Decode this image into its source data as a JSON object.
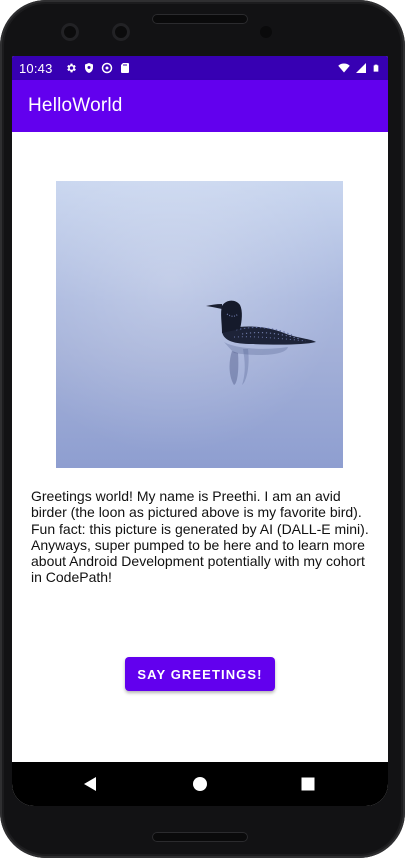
{
  "status_bar": {
    "time": "10:43",
    "left_icons": [
      "gear-icon",
      "shield-icon",
      "at-sign-icon",
      "sd-card-icon"
    ],
    "right_icons": [
      "wifi-icon",
      "signal-icon",
      "battery-icon"
    ]
  },
  "app_bar": {
    "title": "HelloWorld"
  },
  "main": {
    "image_subject": "loon-on-water",
    "bio_text": "Greetings world! My name is Preethi. I am an avid birder (the loon as pictured above is my favorite bird). Fun fact: this picture is generated by AI (DALL-E mini). Anyways, super pumped to be here and to learn more about Android Development potentially with my cohort in CodePath!",
    "button_label": "SAY GREETINGS!"
  },
  "nav_bar": {
    "buttons": [
      "back-icon",
      "home-icon",
      "recents-icon"
    ]
  },
  "colors": {
    "status_bar": "#3700b3",
    "app_bar": "#6200ee",
    "button": "#6200ee",
    "nav_bar": "#000000"
  }
}
